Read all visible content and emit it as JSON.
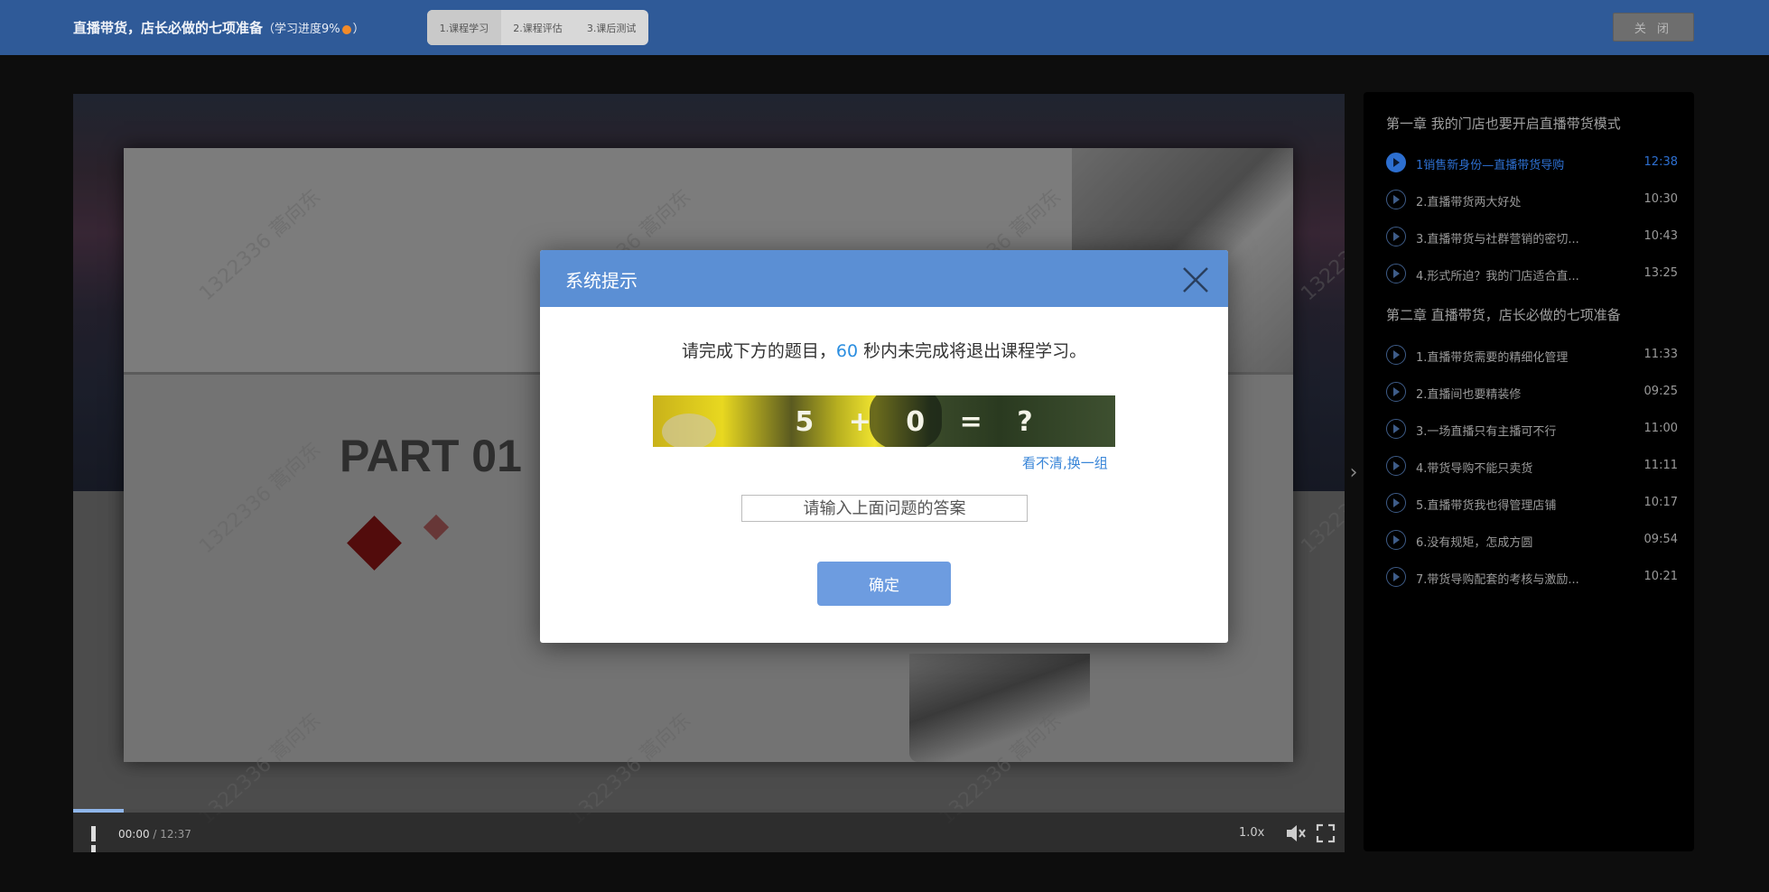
{
  "header": {
    "course_title": "直播带货，店长必做的七项准备",
    "progress_prefix": "（学习进度",
    "progress_value": "9%",
    "progress_suffix": "）",
    "tabs": [
      {
        "label": "1.课程学习",
        "active": true
      },
      {
        "label": "2.课程评估",
        "active": false
      },
      {
        "label": "3.课后测试",
        "active": false
      }
    ],
    "close_label": "关 闭"
  },
  "video": {
    "slide_heading": "PART 01",
    "watermark": "1322336 蒿向东",
    "current_time": "00:00",
    "separator": " / ",
    "duration": "12:37",
    "speed": "1.0x",
    "played_fraction": 0.04
  },
  "playlist": {
    "chapters": [
      {
        "title": "第一章 我的门店也要开启直播带货模式",
        "lessons": [
          {
            "title": "1销售新身份—直播带货导购",
            "duration": "12:38",
            "active": true
          },
          {
            "title": "2.直播带货两大好处",
            "duration": "10:30"
          },
          {
            "title": "3.直播带货与社群营销的密切...",
            "duration": "10:43"
          },
          {
            "title": "4.形式所迫？我的门店适合直...",
            "duration": "13:25"
          }
        ]
      },
      {
        "title": "第二章 直播带货，店长必做的七项准备",
        "lessons": [
          {
            "title": "1.直播带货需要的精细化管理",
            "duration": "11:33"
          },
          {
            "title": "2.直播间也要精装修",
            "duration": "09:25"
          },
          {
            "title": "3.一场直播只有主播可不行",
            "duration": "11:00"
          },
          {
            "title": "4.带货导购不能只卖货",
            "duration": "11:11"
          },
          {
            "title": "5.直播带货我也得管理店铺",
            "duration": "10:17"
          },
          {
            "title": "6.没有规矩，怎成方圆",
            "duration": "09:54"
          },
          {
            "title": "7.带货导购配套的考核与激励...",
            "duration": "10:21"
          }
        ]
      }
    ]
  },
  "modal": {
    "title": "系统提示",
    "message_before": "请完成下方的题目，",
    "countdown": "60",
    "message_after": " 秒内未完成将退出课程学习。",
    "captcha_text": "5 + 0 = ?",
    "refresh_label": "看不清,换一组",
    "answer_placeholder": "请输入上面问题的答案",
    "confirm_label": "确定"
  },
  "colors": {
    "header_bg": "#2f5a98",
    "modal_header": "#5b8fd4",
    "accent_blue": "#2b8ee0",
    "active_lesson": "#2d6fd0",
    "confirm_button": "#6d9ce0"
  }
}
